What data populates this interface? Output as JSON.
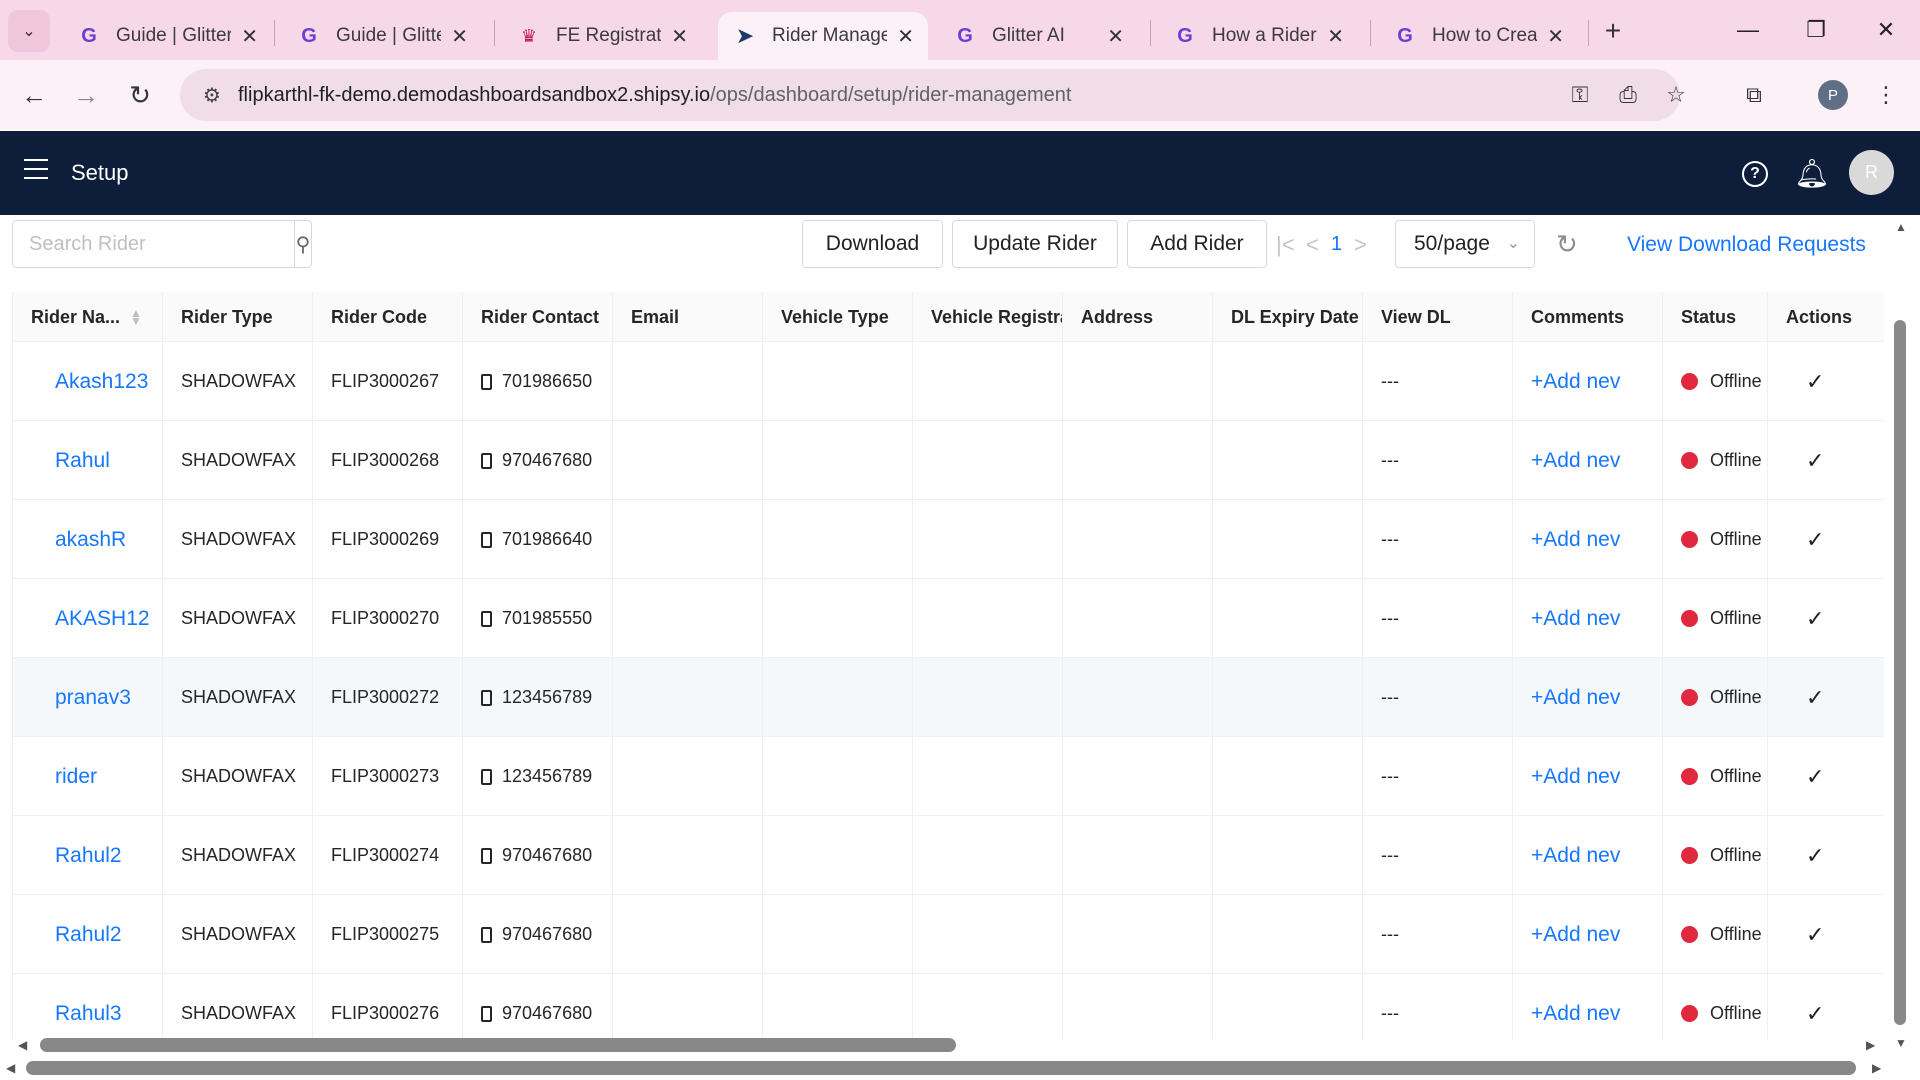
{
  "browser": {
    "tabs": [
      {
        "title": "Guide | Glitter",
        "icon": "glitter-icon"
      },
      {
        "title": "Guide | Glitter",
        "icon": "glitter-icon"
      },
      {
        "title": "FE Registration",
        "icon": "cupcake-icon"
      },
      {
        "title": "Rider Manage",
        "icon": "shipsy-icon"
      },
      {
        "title": "Glitter AI",
        "icon": "glitter-icon"
      },
      {
        "title": "How a Rider r",
        "icon": "glitter-icon"
      },
      {
        "title": "How to Create",
        "icon": "glitter-icon"
      }
    ],
    "url_host": "flipkarthl-fk-demo.demodashboardsandbox2.shipsy.io",
    "url_path": "/ops/dashboard/setup/rider-management",
    "profile_initial": "P"
  },
  "app": {
    "title": "Setup",
    "avatar_initial": "R"
  },
  "controls": {
    "search_placeholder": "Search Rider",
    "download_label": "Download",
    "update_label": "Update Rider",
    "add_label": "Add Rider",
    "page_number": "1",
    "page_size": "50/page",
    "view_downloads_label": "View Download Requests"
  },
  "table": {
    "columns": [
      "Rider Na...",
      "Rider Type",
      "Rider Code",
      "Rider Contact",
      "Email",
      "Vehicle Type",
      "Vehicle Registrat",
      "Address",
      "DL Expiry Date",
      "View DL",
      "Comments",
      "Status",
      "Actions"
    ],
    "rows": [
      {
        "name": "Akash123",
        "type": "SHADOWFAX",
        "code": "FLIP3000267",
        "contact": "701986650",
        "view_dl": "---",
        "comment": "+Add nev",
        "status": "Offline"
      },
      {
        "name": "Rahul",
        "type": "SHADOWFAX",
        "code": "FLIP3000268",
        "contact": "970467680",
        "view_dl": "---",
        "comment": "+Add nev",
        "status": "Offline"
      },
      {
        "name": "akashR",
        "type": "SHADOWFAX",
        "code": "FLIP3000269",
        "contact": "701986640",
        "view_dl": "---",
        "comment": "+Add nev",
        "status": "Offline"
      },
      {
        "name": "AKASH12",
        "type": "SHADOWFAX",
        "code": "FLIP3000270",
        "contact": "701985550",
        "view_dl": "---",
        "comment": "+Add nev",
        "status": "Offline"
      },
      {
        "name": "pranav3",
        "type": "SHADOWFAX",
        "code": "FLIP3000272",
        "contact": "123456789",
        "view_dl": "---",
        "comment": "+Add nev",
        "status": "Offline"
      },
      {
        "name": "rider",
        "type": "SHADOWFAX",
        "code": "FLIP3000273",
        "contact": "123456789",
        "view_dl": "---",
        "comment": "+Add nev",
        "status": "Offline"
      },
      {
        "name": "Rahul2",
        "type": "SHADOWFAX",
        "code": "FLIP3000274",
        "contact": "970467680",
        "view_dl": "---",
        "comment": "+Add nev",
        "status": "Offline"
      },
      {
        "name": "Rahul2",
        "type": "SHADOWFAX",
        "code": "FLIP3000275",
        "contact": "970467680",
        "view_dl": "---",
        "comment": "+Add nev",
        "status": "Offline"
      },
      {
        "name": "Rahul3",
        "type": "SHADOWFAX",
        "code": "FLIP3000276",
        "contact": "970467680",
        "view_dl": "---",
        "comment": "+Add nev",
        "status": "Offline"
      }
    ]
  },
  "colors": {
    "header_bg": "#0d1d3a",
    "link": "#1677ff",
    "status_offline": "#e0283e",
    "tabstrip_bg": "#f7d8e8"
  }
}
